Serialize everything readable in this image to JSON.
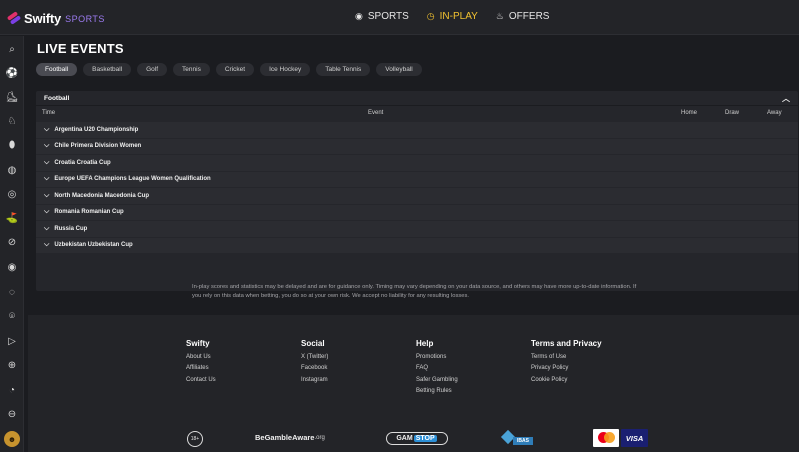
{
  "brand": {
    "name": "Swifty",
    "sub": "SPORTS"
  },
  "nav": [
    {
      "label": "SPORTS",
      "icon": "target-icon",
      "glyph": "◉",
      "active": false
    },
    {
      "label": "IN-PLAY",
      "icon": "clock-icon",
      "glyph": "◷",
      "active": true
    },
    {
      "label": "OFFERS",
      "icon": "flame-icon",
      "glyph": "♨",
      "active": false
    }
  ],
  "sidebar": {
    "icons": [
      {
        "name": "search-icon",
        "glyph": "⌕"
      },
      {
        "name": "football-icon",
        "glyph": "⚽"
      },
      {
        "name": "boot-icon",
        "glyph": "⛸"
      },
      {
        "name": "horse-racing-icon",
        "glyph": "♘"
      },
      {
        "name": "american-football-icon",
        "glyph": "⬮"
      },
      {
        "name": "tennis-icon",
        "glyph": "◍"
      },
      {
        "name": "basketball-icon",
        "glyph": "◎"
      },
      {
        "name": "golf-icon",
        "glyph": "⛳"
      },
      {
        "name": "rugby-icon",
        "glyph": "⊘"
      },
      {
        "name": "darts-icon",
        "glyph": "◉"
      },
      {
        "name": "volleyball-icon",
        "glyph": "◌"
      },
      {
        "name": "location-icon",
        "glyph": "⌾"
      },
      {
        "name": "esports-icon",
        "glyph": "▷"
      },
      {
        "name": "globe-icon",
        "glyph": "⊕"
      },
      {
        "name": "cricket-icon",
        "glyph": "◔"
      },
      {
        "name": "hockey-icon",
        "glyph": "⊖"
      }
    ],
    "avatar_icon": "user-avatar-icon"
  },
  "page": {
    "title": "LIVE EVENTS"
  },
  "tabs": [
    {
      "label": "Football",
      "active": true
    },
    {
      "label": "Basketball",
      "active": false
    },
    {
      "label": "Golf",
      "active": false
    },
    {
      "label": "Tennis",
      "active": false
    },
    {
      "label": "Cricket",
      "active": false
    },
    {
      "label": "Ice Hockey",
      "active": false
    },
    {
      "label": "Table Tennis",
      "active": false
    },
    {
      "label": "Volleyball",
      "active": false
    }
  ],
  "panel": {
    "title": "Football",
    "columns": {
      "time": "Time",
      "event": "Event",
      "home": "Home",
      "draw": "Draw",
      "away": "Away"
    },
    "leagues": [
      "Argentina U20 Championship",
      "Chile Primera Division Women",
      "Croatia Croatia Cup",
      "Europe UEFA Champions League Women Qualification",
      "North Macedonia Macedonia Cup",
      "Romania Romanian Cup",
      "Russia Cup",
      "Uzbekistan Uzbekistan Cup"
    ]
  },
  "disclaimer": "In-play scores and statistics may be delayed and are for guidance only. Timing may vary depending on your data source, and others may have more up-to-date information. If you rely on this data when betting, you do so at your own risk. We accept no liability for any resulting losses.",
  "footer": {
    "columns": [
      {
        "title": "Swifty",
        "links": [
          "About Us",
          "Affiliates",
          "Contact Us"
        ]
      },
      {
        "title": "Social",
        "links": [
          "X (Twitter)",
          "Facebook",
          "Instagram"
        ]
      },
      {
        "title": "Help",
        "links": [
          "Promotions",
          "FAQ",
          "Safer Gambling",
          "Betting Rules"
        ]
      },
      {
        "title": "Terms and Privacy",
        "links": [
          "Terms of Use",
          "Privacy Policy",
          "Cookie Policy"
        ]
      }
    ],
    "badges": {
      "age": "18+",
      "begamble_main": "BeGambleAware",
      "begamble_suffix": ".org",
      "gamstop_a": "GAM",
      "gamstop_b": "STOP",
      "ibas": "IBAS",
      "visa": "VISA"
    }
  },
  "colors": {
    "accent": "#f2c230",
    "background": "#1b1c20",
    "panel": "#25262b",
    "row": "#2b2c31"
  }
}
